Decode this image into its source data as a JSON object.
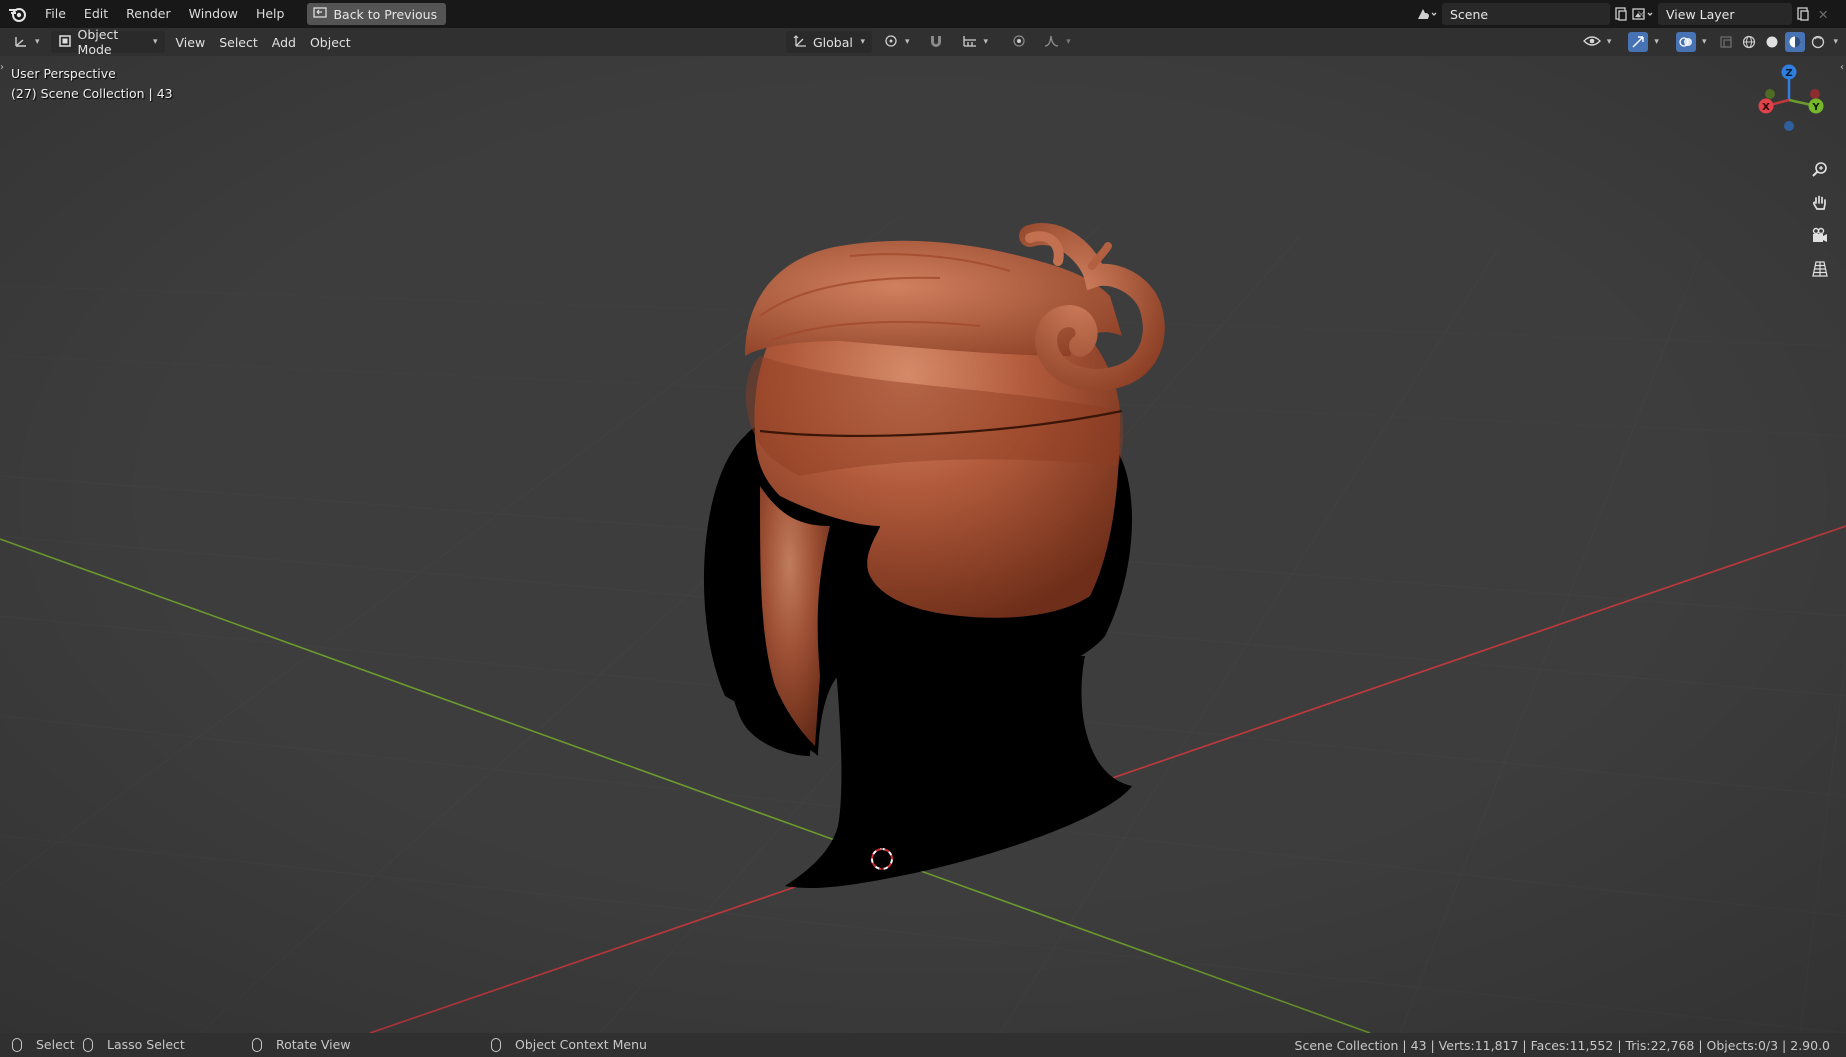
{
  "top_menu": {
    "items": [
      "File",
      "Edit",
      "Render",
      "Window",
      "Help"
    ],
    "back_button": "Back to Previous",
    "scene_field": "Scene",
    "view_layer_field": "View Layer"
  },
  "header": {
    "mode": "Object Mode",
    "menus": [
      "View",
      "Select",
      "Add",
      "Object"
    ],
    "transform_orientation": "Global"
  },
  "viewport": {
    "perspective_label": "User Perspective",
    "collection_label": "(27) Scene Collection | 43",
    "gizmo": {
      "z": "Z",
      "y": "Y",
      "x": "X"
    },
    "colors": {
      "mesh": "#b45a3c",
      "x_axis": "#c0393d",
      "y_axis": "#6b9a2e",
      "z_axis": "#2f7fe0",
      "background": "#3d3d3d"
    }
  },
  "statusbar": {
    "select": "Select",
    "lasso": "Lasso Select",
    "rotate": "Rotate View",
    "context_menu": "Object Context Menu",
    "stats": "Scene Collection | 43 | Verts:11,817 | Faces:11,552 | Tris:22,768 | Objects:0/3 | 2.90.0"
  }
}
